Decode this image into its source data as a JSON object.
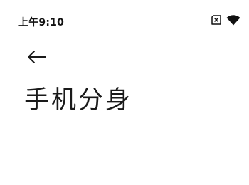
{
  "status_bar": {
    "time": "上午9:10",
    "icons": [
      "sim-off-icon",
      "wifi-icon"
    ]
  },
  "header": {
    "back_icon": "back-arrow-icon",
    "title": "手机分身"
  },
  "colors": {
    "background": "#ffffff",
    "text": "#1a1a1a"
  }
}
